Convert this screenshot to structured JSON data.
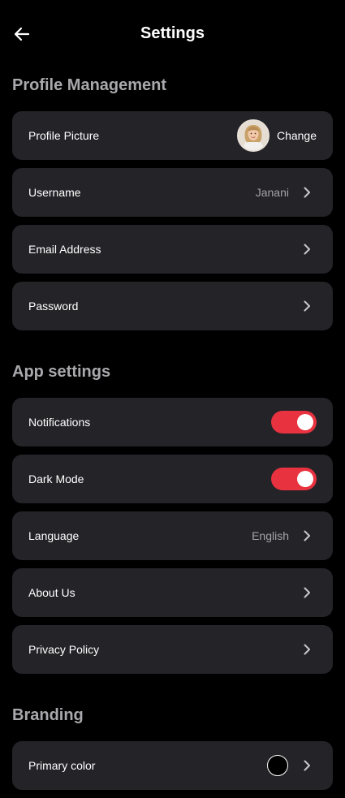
{
  "header": {
    "title": "Settings",
    "back_icon": "arrow-left-icon"
  },
  "profile_section": {
    "title": "Profile Management",
    "profile_picture": {
      "label": "Profile Picture",
      "action": "Change"
    },
    "username": {
      "label": "Username",
      "value": "Janani"
    },
    "email": {
      "label": "Email Address"
    },
    "password": {
      "label": "Password"
    }
  },
  "app_section": {
    "title": "App settings",
    "notifications": {
      "label": "Notifications",
      "enabled": true
    },
    "dark_mode": {
      "label": "Dark Mode",
      "enabled": true
    },
    "language": {
      "label": "Language",
      "value": "English"
    },
    "about": {
      "label": "About Us"
    },
    "privacy": {
      "label": "Privacy Policy"
    }
  },
  "branding_section": {
    "title": "Branding",
    "primary_color": {
      "label": "Primary color",
      "color": "#000000"
    }
  },
  "colors": {
    "background": "#000000",
    "card": "#242328",
    "accent_toggle": "#e8323f",
    "section_title": "#a9a9ad",
    "muted_value": "#a3a3a8"
  },
  "icons": {
    "chevron": "chevron-right-icon",
    "avatar": "user-avatar"
  }
}
